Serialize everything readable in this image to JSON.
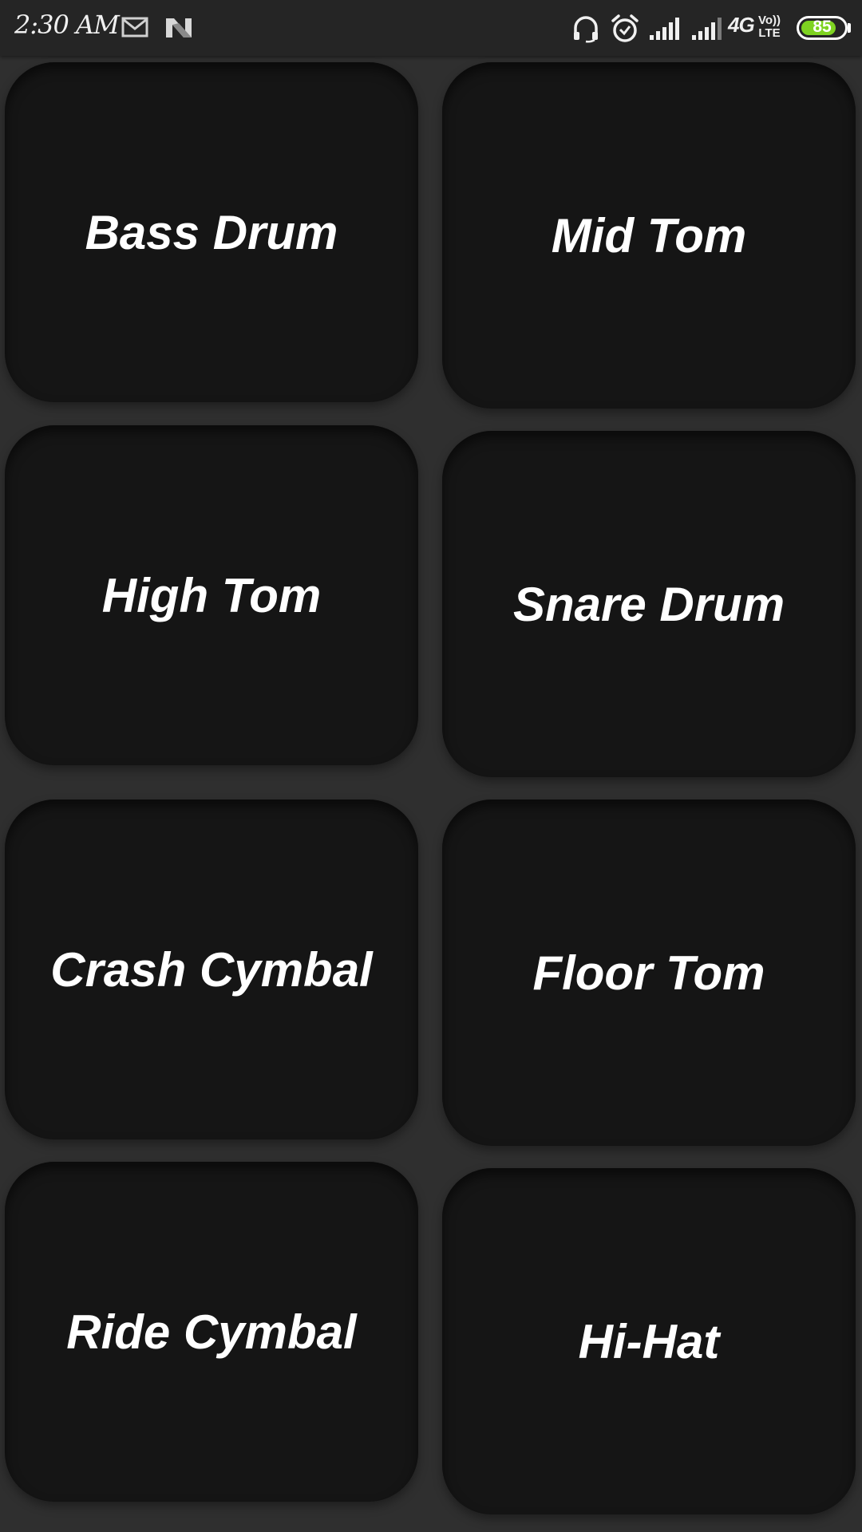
{
  "status_bar": {
    "time": "2:30 AM",
    "icons": [
      "mail-icon",
      "n-app-icon",
      "headset-icon",
      "alarm-icon",
      "signal-icon",
      "signal-icon",
      "4g-icon",
      "volte-icon",
      "battery-icon"
    ],
    "network_label": "4G",
    "volte_top": "Vo))",
    "volte_bottom": "LTE",
    "battery_level": 85,
    "battery_label": "85",
    "battery_color": "#7ed321"
  },
  "pads": [
    {
      "label": "Bass Drum"
    },
    {
      "label": "Mid Tom"
    },
    {
      "label": "High Tom"
    },
    {
      "label": "Snare Drum"
    },
    {
      "label": "Crash Cymbal"
    },
    {
      "label": "Floor Tom"
    },
    {
      "label": "Ride Cymbal"
    },
    {
      "label": "Hi-Hat"
    }
  ],
  "colors": {
    "background": "#2f2f2f",
    "pad": "#151515",
    "pad_text": "#ffffff"
  }
}
